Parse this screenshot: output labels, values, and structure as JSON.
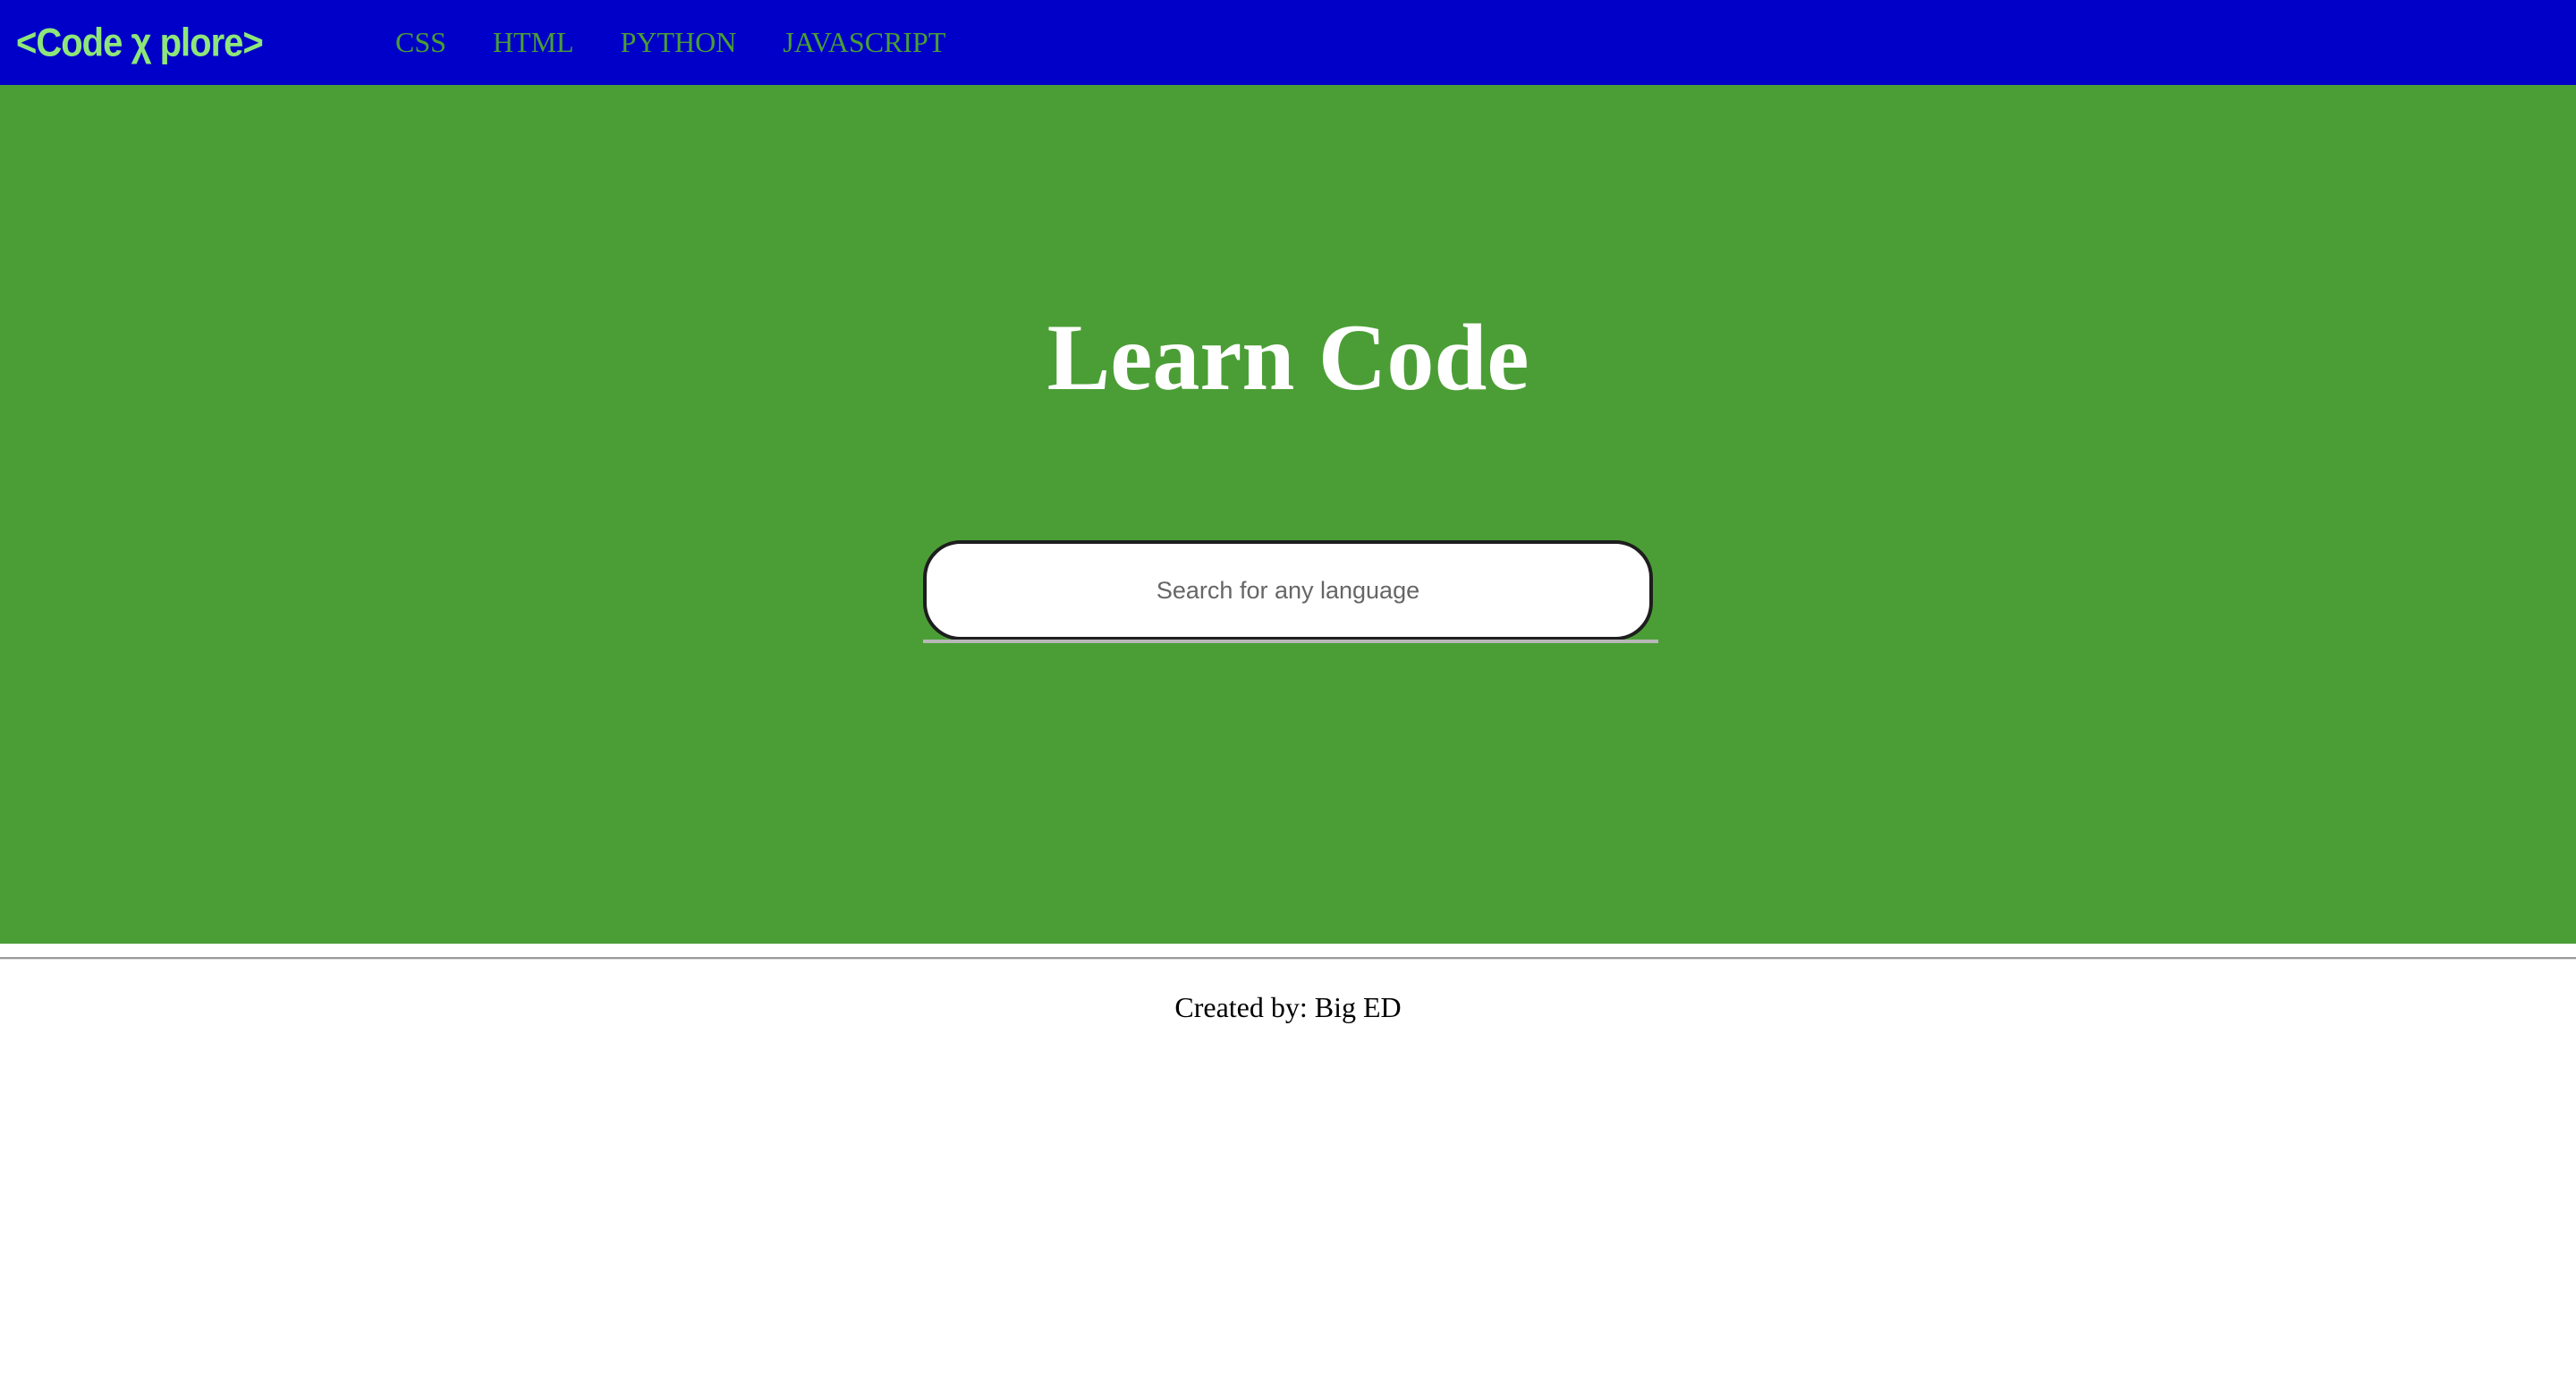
{
  "header": {
    "logo_text": "<Code χ plore>",
    "nav": [
      {
        "label": "CSS"
      },
      {
        "label": "HTML"
      },
      {
        "label": "PYTHON"
      },
      {
        "label": "JAVASCRIPT"
      }
    ]
  },
  "hero": {
    "title": "Learn Code",
    "search": {
      "placeholder": "Search for any language",
      "value": ""
    }
  },
  "footer": {
    "credit": "Created by: Big ED"
  },
  "colors": {
    "header_bg": "#0000c8",
    "hero_bg": "#4b9e36",
    "logo": "#8ee67a",
    "nav_link": "#4a9e35"
  }
}
